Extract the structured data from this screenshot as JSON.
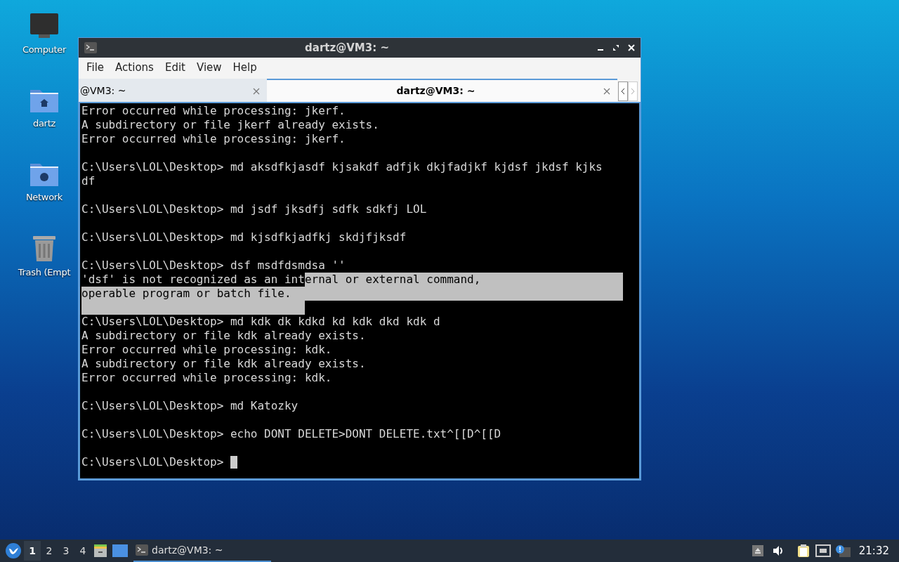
{
  "desktop_icons": [
    {
      "kind": "monitor",
      "label": "Computer"
    },
    {
      "kind": "home",
      "label": "dartz"
    },
    {
      "kind": "network",
      "label": "Network"
    },
    {
      "kind": "trash",
      "label": "Trash (Empt"
    }
  ],
  "window": {
    "title": "dartz@VM3: ~",
    "menu": [
      "File",
      "Actions",
      "Edit",
      "View",
      "Help"
    ],
    "tabs": [
      {
        "label": "@VM3: ~",
        "selected": false
      },
      {
        "label": "dartz@VM3: ~",
        "selected": true
      }
    ],
    "terminal": {
      "lines": [
        {
          "segments": [
            {
              "text": "Error occurred while processing: jkerf.",
              "selected": false
            }
          ]
        },
        {
          "segments": [
            {
              "text": "A subdirectory or file jkerf already exists.",
              "selected": false
            }
          ]
        },
        {
          "segments": [
            {
              "text": "Error occurred while processing: jkerf.",
              "selected": false
            }
          ]
        },
        {
          "kind": "blank"
        },
        {
          "segments": [
            {
              "text": "C:\\Users\\LOL\\Desktop> md aksdfkjasdf kjsakdf adfjk dkjfadjkf kjdsf jkdsf kjks",
              "selected": false
            }
          ]
        },
        {
          "segments": [
            {
              "text": "df",
              "selected": false
            }
          ]
        },
        {
          "kind": "blank"
        },
        {
          "segments": [
            {
              "text": "C:\\Users\\LOL\\Desktop> md jsdf jksdfj sdfk sdkfj LOL",
              "selected": false
            }
          ]
        },
        {
          "kind": "blank"
        },
        {
          "segments": [
            {
              "text": "C:\\Users\\LOL\\Desktop> md kjsdfkjadfkj skdjfjksdf",
              "selected": false
            }
          ]
        },
        {
          "kind": "blank"
        },
        {
          "segments": [
            {
              "text": "C:\\Users\\LOL\\Desktop> dsf msdfdsmdsa ''",
              "selected": false
            }
          ]
        },
        {
          "segments": [
            {
              "text": "'dsf' is not recognized as an int",
              "selected": false
            },
            {
              "text": "ernal or external command,",
              "selected": true
            }
          ]
        },
        {
          "segments": [
            {
              "text": "operable program or batch file.",
              "selected": true
            }
          ]
        },
        {
          "kind": "selection_tail"
        },
        {
          "segments": [
            {
              "text": "C:\\Users\\LOL\\Desktop> md kdk dk kdkd kd kdk dkd kdk d",
              "selected": false
            }
          ]
        },
        {
          "segments": [
            {
              "text": "A subdirectory or file kdk already exists.",
              "selected": false
            }
          ]
        },
        {
          "segments": [
            {
              "text": "Error occurred while processing: kdk.",
              "selected": false
            }
          ]
        },
        {
          "segments": [
            {
              "text": "A subdirectory or file kdk already exists.",
              "selected": false
            }
          ]
        },
        {
          "segments": [
            {
              "text": "Error occurred while processing: kdk.",
              "selected": false
            }
          ]
        },
        {
          "kind": "blank"
        },
        {
          "segments": [
            {
              "text": "C:\\Users\\LOL\\Desktop> md Katozky",
              "selected": false
            }
          ]
        },
        {
          "kind": "blank"
        },
        {
          "segments": [
            {
              "text": "C:\\Users\\LOL\\Desktop> echo DONT DELETE>DONT DELETE.txt^[[D^[[D",
              "selected": false
            }
          ]
        },
        {
          "kind": "blank"
        },
        {
          "segments": [
            {
              "text": "C:\\Users\\LOL\\Desktop> ",
              "selected": false
            }
          ],
          "cursor": true
        }
      ]
    }
  },
  "taskbar": {
    "workspaces": [
      {
        "label": "1",
        "selected": true
      },
      {
        "label": "2",
        "selected": false
      },
      {
        "label": "3",
        "selected": false
      },
      {
        "label": "4",
        "selected": false
      }
    ],
    "tasks": [
      {
        "label": "dartz@VM3: ~",
        "selected": true
      }
    ],
    "clock": "21:32"
  }
}
